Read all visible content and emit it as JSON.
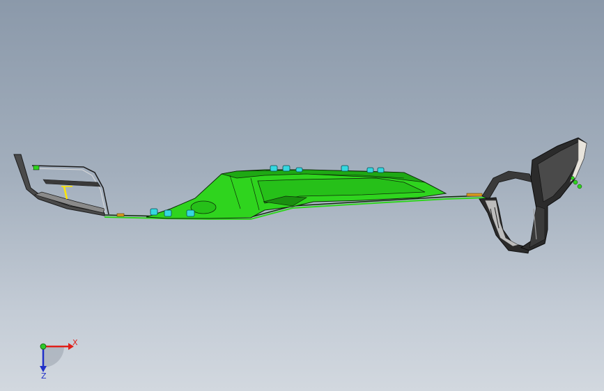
{
  "viewport": {
    "background_top": "#8b99aa",
    "background_bottom": "#d2d8df"
  },
  "model": {
    "body_color": "#2fd41e",
    "body_dark": "#1a8f10",
    "edge_color": "#0d2a08",
    "fastener_color": "#35d8e0",
    "bracket_color": "#3a3a3a",
    "handle_color": "#2b2b2b",
    "handle_highlight": "#e8e4dc",
    "accent_yellow": "#ffe600",
    "accent_orange": "#d89a20"
  },
  "triad": {
    "x_label": "X",
    "z_label": "Z",
    "x_color": "#e0201a",
    "y_color": "#2ec82a",
    "z_color": "#2030c8"
  }
}
